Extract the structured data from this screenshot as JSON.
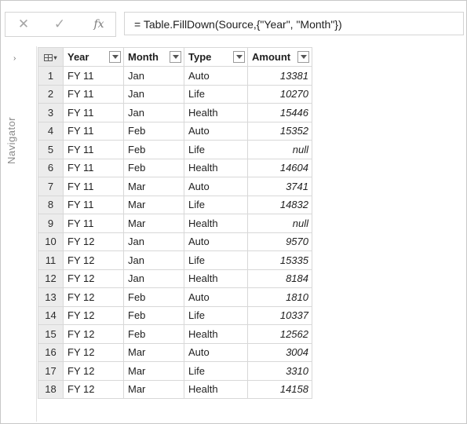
{
  "formula_bar": {
    "cancel_icon": "✕",
    "confirm_icon": "✓",
    "fx_label": "fx",
    "formula": "= Table.FillDown(Source,{\"Year\", \"Month\"})"
  },
  "navigator": {
    "chevron": "›",
    "label": "Navigator"
  },
  "table": {
    "columns": [
      "Year",
      "Month",
      "Type",
      "Amount"
    ],
    "rows": [
      {
        "n": "1",
        "year": "FY 11",
        "month": "Jan",
        "type": "Auto",
        "amount": "13381"
      },
      {
        "n": "2",
        "year": "FY 11",
        "month": "Jan",
        "type": "Life",
        "amount": "10270"
      },
      {
        "n": "3",
        "year": "FY 11",
        "month": "Jan",
        "type": "Health",
        "amount": "15446"
      },
      {
        "n": "4",
        "year": "FY 11",
        "month": "Feb",
        "type": "Auto",
        "amount": "15352"
      },
      {
        "n": "5",
        "year": "FY 11",
        "month": "Feb",
        "type": "Life",
        "amount": "null"
      },
      {
        "n": "6",
        "year": "FY 11",
        "month": "Feb",
        "type": "Health",
        "amount": "14604"
      },
      {
        "n": "7",
        "year": "FY 11",
        "month": "Mar",
        "type": "Auto",
        "amount": "3741"
      },
      {
        "n": "8",
        "year": "FY 11",
        "month": "Mar",
        "type": "Life",
        "amount": "14832"
      },
      {
        "n": "9",
        "year": "FY 11",
        "month": "Mar",
        "type": "Health",
        "amount": "null"
      },
      {
        "n": "10",
        "year": "FY 12",
        "month": "Jan",
        "type": "Auto",
        "amount": "9570"
      },
      {
        "n": "11",
        "year": "FY 12",
        "month": "Jan",
        "type": "Life",
        "amount": "15335"
      },
      {
        "n": "12",
        "year": "FY 12",
        "month": "Jan",
        "type": "Health",
        "amount": "8184"
      },
      {
        "n": "13",
        "year": "FY 12",
        "month": "Feb",
        "type": "Auto",
        "amount": "1810"
      },
      {
        "n": "14",
        "year": "FY 12",
        "month": "Feb",
        "type": "Life",
        "amount": "10337"
      },
      {
        "n": "15",
        "year": "FY 12",
        "month": "Feb",
        "type": "Health",
        "amount": "12562"
      },
      {
        "n": "16",
        "year": "FY 12",
        "month": "Mar",
        "type": "Auto",
        "amount": "3004"
      },
      {
        "n": "17",
        "year": "FY 12",
        "month": "Mar",
        "type": "Life",
        "amount": "3310"
      },
      {
        "n": "18",
        "year": "FY 12",
        "month": "Mar",
        "type": "Health",
        "amount": "14158"
      }
    ]
  }
}
